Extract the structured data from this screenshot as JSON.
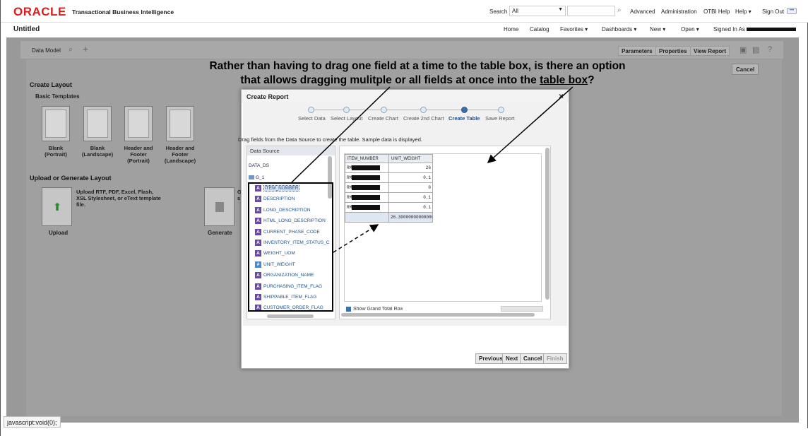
{
  "header": {
    "logo": "ORACLE",
    "product": "Transactional Business Intelligence",
    "search_label": "Search",
    "search_scope": "All",
    "links": {
      "advanced": "Advanced",
      "administration": "Administration",
      "otbi_help": "OTBI Help",
      "help": "Help ▾",
      "sign_out": "Sign Out"
    },
    "more_icon": "•••"
  },
  "titlebar": {
    "title": "Untitled",
    "nav": {
      "home": "Home",
      "catalog": "Catalog",
      "favorites": "Favorites ▾",
      "dashboards": "Dashboards ▾",
      "new": "New ▾",
      "open": "Open ▾",
      "signed_in": "Signed In As"
    }
  },
  "toolbar": {
    "data_model": "Data Model",
    "parameters": "Parameters",
    "properties": "Properties",
    "view_report": "View Report"
  },
  "layout": {
    "create_layout": "Create Layout",
    "basic_templates": "Basic Templates",
    "templates": [
      {
        "line1": "Blank",
        "line2": "(Portrait)",
        "line3": ""
      },
      {
        "line1": "Blank",
        "line2": "(Landscape)",
        "line3": ""
      },
      {
        "line1": "Header and",
        "line2": "Footer",
        "line3": "(Portrait)"
      },
      {
        "line1": "Header and",
        "line2": "Footer",
        "line3": "(Landscape)"
      }
    ],
    "upload_title": "Upload or Generate Layout",
    "upload_text": "Upload RTF, PDF, Excel, Flash, XSL Stylesheet, or eText template file.",
    "upload_label": "Upload",
    "generate_label": "Generate",
    "generate_partial_1": "G",
    "generate_partial_2": "s",
    "cancel": "Cancel"
  },
  "annotation": {
    "line1": "Rather than having to drag one field at a time to the table box, is there an option",
    "line2_prefix": "that allows dragging mulitple or all fields at once into the ",
    "line2_underlined": "table box",
    "line2_suffix": "?"
  },
  "dialog": {
    "title": "Create Report",
    "close": "×",
    "steps": [
      {
        "label": "Select Data",
        "active": false
      },
      {
        "label": "Select Layout",
        "active": false
      },
      {
        "label": "Create Chart",
        "active": false
      },
      {
        "label": "Create 2nd Chart",
        "active": false
      },
      {
        "label": "Create Table",
        "active": true
      },
      {
        "label": "Save Report",
        "active": false
      }
    ],
    "instruction": "Drag fields from the Data Source to create the table. Sample data is displayed.",
    "data_source_header": "Data Source",
    "ds_name": "DATA_DS",
    "group_name": "G_1",
    "fields": [
      {
        "name": "ITEM_NUMBER",
        "type": "A"
      },
      {
        "name": "DESCRIPTION",
        "type": "A"
      },
      {
        "name": "LONG_DESCRIPTION",
        "type": "A"
      },
      {
        "name": "HTML_LONG_DESCRIPTION",
        "type": "A"
      },
      {
        "name": "CURRENT_PHASE_CODE",
        "type": "A"
      },
      {
        "name": "INVENTORY_ITEM_STATUS_C",
        "type": "A"
      },
      {
        "name": "WEIGHT_UOM",
        "type": "A"
      },
      {
        "name": "UNIT_WEIGHT",
        "type": "#"
      },
      {
        "name": "ORGANIZATION_NAME",
        "type": "A"
      },
      {
        "name": "PURCHASING_ITEM_FLAG",
        "type": "A"
      },
      {
        "name": "SHIPPABLE_ITEM_FLAG",
        "type": "A"
      },
      {
        "name": "CUSTOMER_ORDER_FLAG",
        "type": "A"
      }
    ],
    "table": {
      "columns": [
        "ITEM_NUMBER",
        "UNIT_WEIGHT"
      ],
      "rows": [
        {
          "item": "RM",
          "weight": "26"
        },
        {
          "item": "RM",
          "weight": "0.1"
        },
        {
          "item": "RM",
          "weight": "0"
        },
        {
          "item": "RM",
          "weight": "0.1"
        },
        {
          "item": "RM",
          "weight": "0.1"
        }
      ],
      "total": "26.30000000000000"
    },
    "grand_total_label": "Show Grand Total Row",
    "buttons": {
      "previous": "Previous",
      "next": "Next",
      "cancel": "Cancel",
      "finish": "Finish"
    }
  },
  "status_bar": "javascript:void(0);",
  "colors": {
    "oracle_red": "#e01b1b",
    "active_step": "#1b4f8a",
    "workspace": "#999999"
  }
}
